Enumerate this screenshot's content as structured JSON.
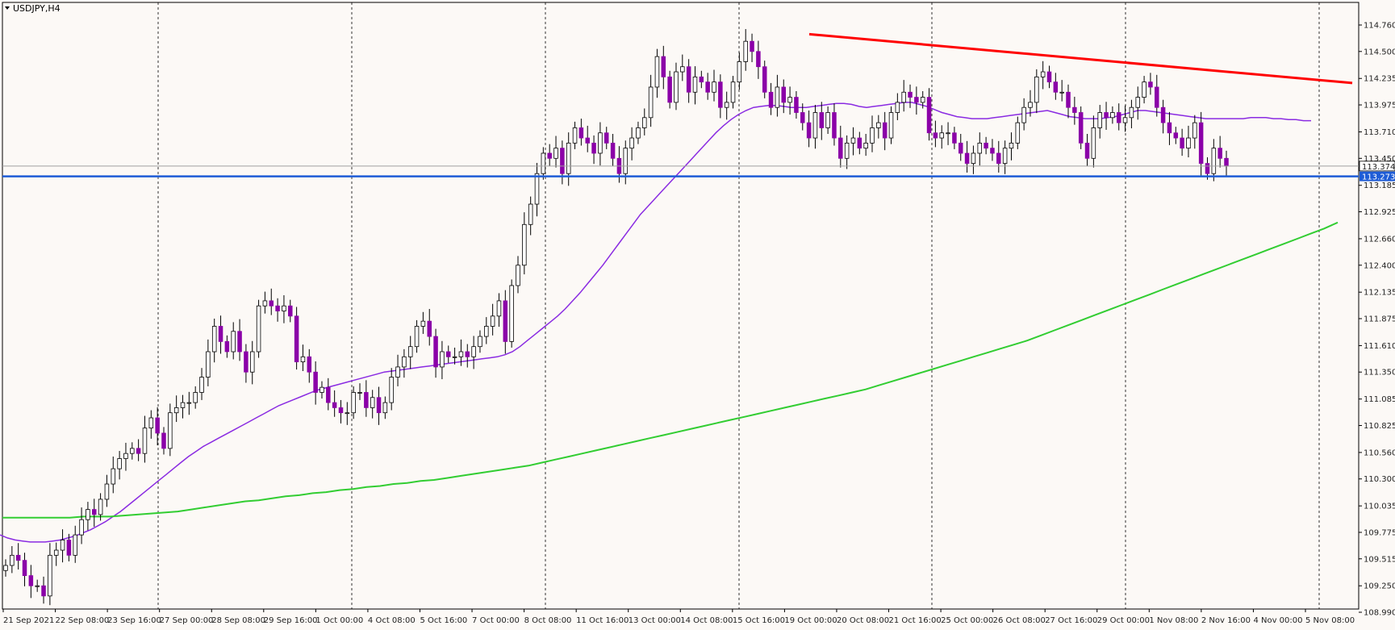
{
  "header": {
    "symbol_label": "USDJPY,H4"
  },
  "colors": {
    "background": "#fcf9f6",
    "bull_candle": "#ffffff",
    "bear_candle": "#8b00a8",
    "wick": "#000000",
    "ma_fast": "#8a2be2",
    "ma_slow": "#32cd32",
    "trendline": "#ff0000",
    "support_line": "#1e5cd6",
    "price_line": "#a0a0a0"
  },
  "chart_data": {
    "type": "candlestick",
    "symbol": "USDJPY",
    "timeframe": "H4",
    "ylim": [
      108.99,
      114.76
    ],
    "y_ticks": [
      "114.760",
      "114.500",
      "114.235",
      "113.975",
      "113.710",
      "113.450",
      "113.185",
      "112.925",
      "112.660",
      "112.400",
      "112.135",
      "111.875",
      "111.610",
      "111.350",
      "111.085",
      "110.825",
      "110.560",
      "110.300",
      "110.035",
      "109.775",
      "109.515",
      "109.250",
      "108.990"
    ],
    "x_ticks": [
      "21 Sep 2021",
      "22 Sep 08:00",
      "23 Sep 16:00",
      "27 Sep 00:00",
      "28 Sep 08:00",
      "29 Sep 16:00",
      "1 Oct 00:00",
      "4 Oct 08:00",
      "5 Oct 16:00",
      "7 Oct 00:00",
      "8 Oct 08:00",
      "11 Oct 16:00",
      "13 Oct 00:00",
      "14 Oct 08:00",
      "15 Oct 16:00",
      "19 Oct 00:00",
      "20 Oct 08:00",
      "21 Oct 16:00",
      "25 Oct 00:00",
      "26 Oct 08:00",
      "27 Oct 16:00",
      "29 Oct 00:00",
      "1 Nov 08:00",
      "2 Nov 16:00",
      "4 Nov 00:00",
      "5 Nov 08:00"
    ],
    "closes": [
      109.45,
      109.55,
      109.5,
      109.35,
      109.25,
      109.25,
      109.15,
      109.55,
      109.6,
      109.7,
      109.55,
      109.75,
      109.9,
      110.0,
      109.95,
      110.1,
      110.25,
      110.4,
      110.5,
      110.55,
      110.6,
      110.55,
      110.8,
      110.9,
      110.75,
      110.6,
      110.95,
      111.0,
      111.05,
      111.05,
      111.15,
      111.3,
      111.55,
      111.8,
      111.65,
      111.55,
      111.75,
      111.55,
      111.35,
      111.55,
      112.0,
      112.05,
      112.0,
      111.95,
      112.0,
      111.9,
      111.45,
      111.5,
      111.35,
      111.15,
      111.2,
      111.05,
      111.0,
      110.95,
      110.95,
      111.15,
      111.15,
      111.0,
      111.1,
      110.95,
      111.05,
      111.3,
      111.4,
      111.5,
      111.6,
      111.8,
      111.85,
      111.7,
      111.4,
      111.55,
      111.5,
      111.5,
      111.55,
      111.5,
      111.6,
      111.7,
      111.8,
      111.9,
      112.05,
      111.65,
      112.2,
      112.4,
      112.8,
      113.0,
      113.3,
      113.5,
      113.45,
      113.55,
      113.3,
      113.6,
      113.75,
      113.65,
      113.6,
      113.5,
      113.7,
      113.6,
      113.45,
      113.3,
      113.55,
      113.65,
      113.75,
      113.85,
      114.15,
      114.45,
      114.25,
      114.0,
      114.3,
      114.35,
      114.1,
      114.25,
      114.2,
      114.1,
      114.2,
      113.95,
      114.0,
      114.2,
      114.4,
      114.6,
      114.5,
      114.35,
      114.1,
      113.95,
      114.15,
      114.0,
      114.05,
      113.9,
      113.8,
      113.65,
      113.9,
      113.75,
      113.9,
      113.65,
      113.45,
      113.6,
      113.65,
      113.55,
      113.6,
      113.75,
      113.8,
      113.65,
      113.9,
      114.0,
      114.1,
      114.05,
      114.0,
      114.05,
      113.7,
      113.65,
      113.7,
      113.7,
      113.6,
      113.5,
      113.4,
      113.5,
      113.6,
      113.55,
      113.5,
      113.4,
      113.55,
      113.6,
      113.8,
      113.95,
      114.0,
      114.25,
      114.3,
      114.2,
      114.1,
      114.1,
      113.95,
      113.9,
      113.6,
      113.45,
      113.75,
      113.9,
      113.85,
      113.9,
      113.8,
      113.85,
      113.95,
      114.05,
      114.2,
      114.15,
      113.95,
      113.8,
      113.7,
      113.65,
      113.55,
      113.65,
      113.8,
      113.4,
      113.3,
      113.55,
      113.45,
      113.374
    ]
  },
  "indicators": [
    {
      "name": "MA fast",
      "values": [
        109.75,
        109.72,
        109.7,
        109.69,
        109.68,
        109.68,
        109.68,
        109.69,
        109.7,
        109.72,
        109.74,
        109.77,
        109.8,
        109.84,
        109.88,
        109.93,
        109.98,
        110.04,
        110.1,
        110.16,
        110.22,
        110.28,
        110.34,
        110.4,
        110.46,
        110.52,
        110.57,
        110.62,
        110.66,
        110.7,
        110.74,
        110.78,
        110.82,
        110.86,
        110.9,
        110.94,
        110.98,
        111.02,
        111.05,
        111.08,
        111.11,
        111.14,
        111.17,
        111.19,
        111.21,
        111.23,
        111.25,
        111.27,
        111.29,
        111.31,
        111.33,
        111.35,
        111.36,
        111.37,
        111.38,
        111.39,
        111.4,
        111.41,
        111.42,
        111.43,
        111.44,
        111.45,
        111.46,
        111.47,
        111.48,
        111.49,
        111.5,
        111.52,
        111.55,
        111.6,
        111.66,
        111.72,
        111.78,
        111.84,
        111.9,
        111.97,
        112.05,
        112.13,
        112.22,
        112.31,
        112.4,
        112.5,
        112.6,
        112.7,
        112.8,
        112.9,
        112.98,
        113.06,
        113.14,
        113.22,
        113.3,
        113.38,
        113.46,
        113.54,
        113.62,
        113.7,
        113.77,
        113.83,
        113.88,
        113.92,
        113.95,
        113.96,
        113.97,
        113.97,
        113.96,
        113.95,
        113.95,
        113.95,
        113.96,
        113.97,
        113.98,
        113.99,
        113.99,
        113.98,
        113.96,
        113.95,
        113.96,
        113.97,
        113.98,
        113.99,
        114.0,
        114.0,
        113.98,
        113.96,
        113.93,
        113.9,
        113.88,
        113.86,
        113.85,
        113.84,
        113.84,
        113.84,
        113.85,
        113.86,
        113.87,
        113.88,
        113.89,
        113.9,
        113.91,
        113.92,
        113.9,
        113.88,
        113.86,
        113.85,
        113.84,
        113.84,
        113.84,
        113.85,
        113.86,
        113.88,
        113.9,
        113.92,
        113.92,
        113.91,
        113.9,
        113.89,
        113.88,
        113.87,
        113.86,
        113.85,
        113.84,
        113.84,
        113.84,
        113.84,
        113.84,
        113.84,
        113.85,
        113.85,
        113.85,
        113.84,
        113.84,
        113.83,
        113.83,
        113.82,
        113.82
      ]
    },
    {
      "name": "MA slow",
      "values": [
        109.92,
        109.92,
        109.92,
        109.92,
        109.92,
        109.92,
        109.93,
        109.93,
        109.93,
        109.94,
        109.95,
        109.96,
        109.97,
        109.98,
        110.0,
        110.02,
        110.04,
        110.06,
        110.08,
        110.09,
        110.11,
        110.13,
        110.14,
        110.16,
        110.17,
        110.19,
        110.2,
        110.22,
        110.23,
        110.25,
        110.26,
        110.28,
        110.29,
        110.31,
        110.33,
        110.35,
        110.37,
        110.39,
        110.41,
        110.43,
        110.46,
        110.49,
        110.52,
        110.55,
        110.58,
        110.61,
        110.64,
        110.67,
        110.7,
        110.73,
        110.76,
        110.79,
        110.82,
        110.85,
        110.88,
        110.91,
        110.94,
        110.97,
        111.0,
        111.03,
        111.06,
        111.09,
        111.12,
        111.15,
        111.18,
        111.22,
        111.26,
        111.3,
        111.34,
        111.38,
        111.42,
        111.46,
        111.5,
        111.54,
        111.58,
        111.62,
        111.66,
        111.71,
        111.76,
        111.81,
        111.86,
        111.91,
        111.96,
        112.01,
        112.06,
        112.11,
        112.16,
        112.21,
        112.26,
        112.31,
        112.36,
        112.41,
        112.46,
        112.51,
        112.56,
        112.61,
        112.66,
        112.71,
        112.76,
        112.82
      ]
    }
  ],
  "annotations": {
    "current_price_label": "113.374",
    "support_label": "113.273"
  }
}
